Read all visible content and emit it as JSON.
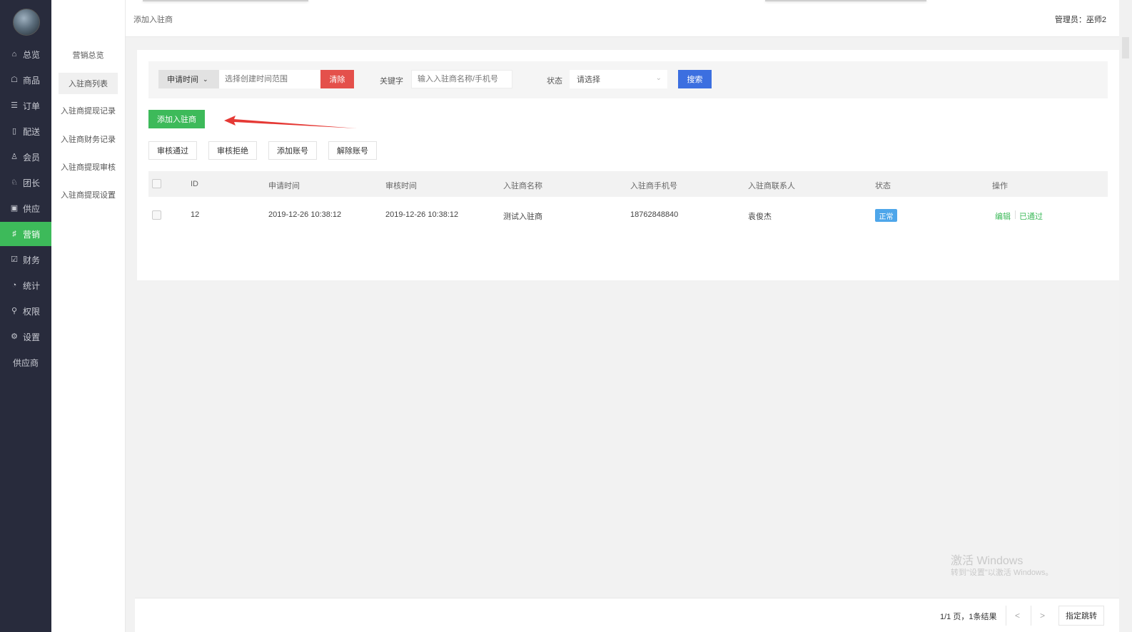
{
  "sidebar": {
    "items": [
      {
        "icon": "home-icon",
        "glyph": "⌂",
        "label": "总览"
      },
      {
        "icon": "goods-icon",
        "glyph": "☖",
        "label": "商品"
      },
      {
        "icon": "order-icon",
        "glyph": "☰",
        "label": "订单"
      },
      {
        "icon": "delivery-icon",
        "glyph": "▯",
        "label": "配送"
      },
      {
        "icon": "member-icon",
        "glyph": "♙",
        "label": "会员"
      },
      {
        "icon": "leader-icon",
        "glyph": "♘",
        "label": "团长"
      },
      {
        "icon": "supply-icon",
        "glyph": "▣",
        "label": "供应"
      },
      {
        "icon": "marketing-icon",
        "glyph": "♯",
        "label": "营销"
      },
      {
        "icon": "finance-icon",
        "glyph": "☑",
        "label": "财务"
      },
      {
        "icon": "stats-icon",
        "glyph": "◔",
        "label": "统计"
      },
      {
        "icon": "permission-icon",
        "glyph": "⚲",
        "label": "权限"
      },
      {
        "icon": "settings-icon",
        "glyph": "⚙",
        "label": "设置"
      }
    ],
    "extra": "供应商",
    "active_color": "#3dba5a"
  },
  "subnav": {
    "items": [
      "营销总览",
      "入驻商列表",
      "入驻商提现记录",
      "入驻商财务记录",
      "入驻商提现审核",
      "入驻商提现设置"
    ]
  },
  "header": {
    "breadcrumb": "添加入驻商",
    "admin": "管理员：巫师2"
  },
  "filter": {
    "time_select": "申请时间",
    "date_placeholder": "选择创建时间范围",
    "clear_label": "清除",
    "keyword_label": "关键字",
    "keyword_placeholder": "输入入驻商名称/手机号",
    "status_label": "状态",
    "status_value": "请选择",
    "search_label": "搜索"
  },
  "actions": {
    "add_label": "添加入驻商",
    "approve": "审核通过",
    "reject": "审核拒绝",
    "add_account": "添加账号",
    "remove_account": "解除账号"
  },
  "table": {
    "headers": [
      "ID",
      "申请时间",
      "审核时间",
      "入驻商名称",
      "入驻商手机号",
      "入驻商联系人",
      "状态",
      "操作"
    ],
    "rows": [
      {
        "id": "12",
        "apply_time": "2019-12-26 10:38:12",
        "audit_time": "2019-12-26 10:38:12",
        "name": "测试入驻商",
        "phone": "18762848840",
        "contact": "袁俊杰",
        "status": "正常",
        "op_edit": "编辑",
        "op_state": "已通过"
      }
    ]
  },
  "watermark": {
    "line1": "激活 Windows",
    "line2": "转到\"设置\"以激活 Windows。"
  },
  "pager": {
    "info": "1/1 页，1条结果",
    "prev": "<",
    "next": ">",
    "jump": "指定跳转"
  }
}
